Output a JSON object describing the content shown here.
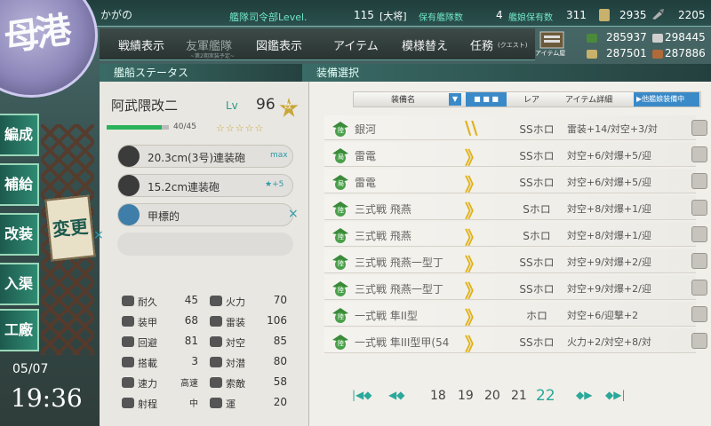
{
  "header": {
    "admiral_name": "かがの",
    "hq_label": "艦隊司令部Level.",
    "hq_level": "115",
    "rank": "[大将]",
    "ship_count_label": "保有艦隊数",
    "ship_count": "4",
    "equip_count_label": "艦娘保有数",
    "equip_count": "311",
    "buckets": "2935",
    "dev_materials": "2205"
  },
  "resources": {
    "fuel": "285937",
    "ammo": "298445",
    "steel": "287501",
    "bauxite": "287886"
  },
  "nav": {
    "items": [
      {
        "label": "戦績表示"
      },
      {
        "label": "友軍艦隊"
      },
      {
        "label": "図鑑表示"
      },
      {
        "label": "アイテム"
      },
      {
        "label": "模様替え"
      },
      {
        "label": "任務"
      }
    ],
    "friend_sub": "~第2期実装予定~",
    "quest_sub": "(クエスト)",
    "item_shop_label": "アイテム屋"
  },
  "side_menu": {
    "items": [
      {
        "label": "編成"
      },
      {
        "label": "補給"
      },
      {
        "label": "改装"
      },
      {
        "label": "入渠"
      },
      {
        "label": "工廠"
      }
    ],
    "henko_label": "変更"
  },
  "clock": {
    "date": "05/07",
    "time": "19:36"
  },
  "status": {
    "section_title": "艦船ステータス",
    "ship_name": "阿武隈改二",
    "lv_label": "Lv",
    "lv_value": "96",
    "kai_badge": "改",
    "hp": "40/45",
    "stars": "☆☆☆☆☆",
    "slots": [
      {
        "name": "20.3cm(3号)連装砲",
        "badge": "max"
      },
      {
        "name": "15.2cm連装砲",
        "badge": "★+5"
      },
      {
        "name": "甲標的",
        "badge": ""
      }
    ],
    "stats": [
      {
        "label": "耐久",
        "value": "45"
      },
      {
        "label": "火力",
        "value": "70"
      },
      {
        "label": "装甲",
        "value": "68"
      },
      {
        "label": "雷装",
        "value": "106"
      },
      {
        "label": "回避",
        "value": "81"
      },
      {
        "label": "対空",
        "value": "85"
      },
      {
        "label": "搭載",
        "value": "3"
      },
      {
        "label": "対潜",
        "value": "80"
      },
      {
        "label": "速力",
        "value": "高速"
      },
      {
        "label": "索敵",
        "value": "58"
      },
      {
        "label": "射程",
        "value": "中"
      },
      {
        "label": "運",
        "value": "20"
      }
    ]
  },
  "equip": {
    "section_title": "装備選択",
    "headers": {
      "name": "装備名",
      "rarity": "レア",
      "detail": "アイテム詳細",
      "other": "▶他艦娘装備中"
    },
    "rows": [
      {
        "icon": "陸",
        "name": "銀河",
        "rarity": "SSホロ",
        "detail": "雷装+14/対空+3/対"
      },
      {
        "icon": "局",
        "name": "雷電",
        "rarity": "SSホロ",
        "detail": "対空+6/対爆+5/迎"
      },
      {
        "icon": "局",
        "name": "雷電",
        "rarity": "SSホロ",
        "detail": "対空+6/対爆+5/迎"
      },
      {
        "icon": "陸",
        "name": "三式戦 飛燕",
        "rarity": "Sホロ",
        "detail": "対空+8/対爆+1/迎"
      },
      {
        "icon": "陸",
        "name": "三式戦 飛燕",
        "rarity": "Sホロ",
        "detail": "対空+8/対爆+1/迎"
      },
      {
        "icon": "陸",
        "name": "三式戦 飛燕一型丁",
        "rarity": "SSホロ",
        "detail": "対空+9/対爆+2/迎"
      },
      {
        "icon": "陸",
        "name": "三式戦 飛燕一型丁",
        "rarity": "SSホロ",
        "detail": "対空+9/対爆+2/迎"
      },
      {
        "icon": "陸",
        "name": "一式戦 隼II型",
        "rarity": "ホロ",
        "detail": "対空+6/迎撃+2"
      },
      {
        "icon": "陸",
        "name": "一式戦 隼III型甲(54",
        "rarity": "SSホロ",
        "detail": "火力+2/対空+8/対"
      }
    ],
    "pages": [
      "18",
      "19",
      "20",
      "21",
      "22"
    ],
    "current_page": "22"
  }
}
